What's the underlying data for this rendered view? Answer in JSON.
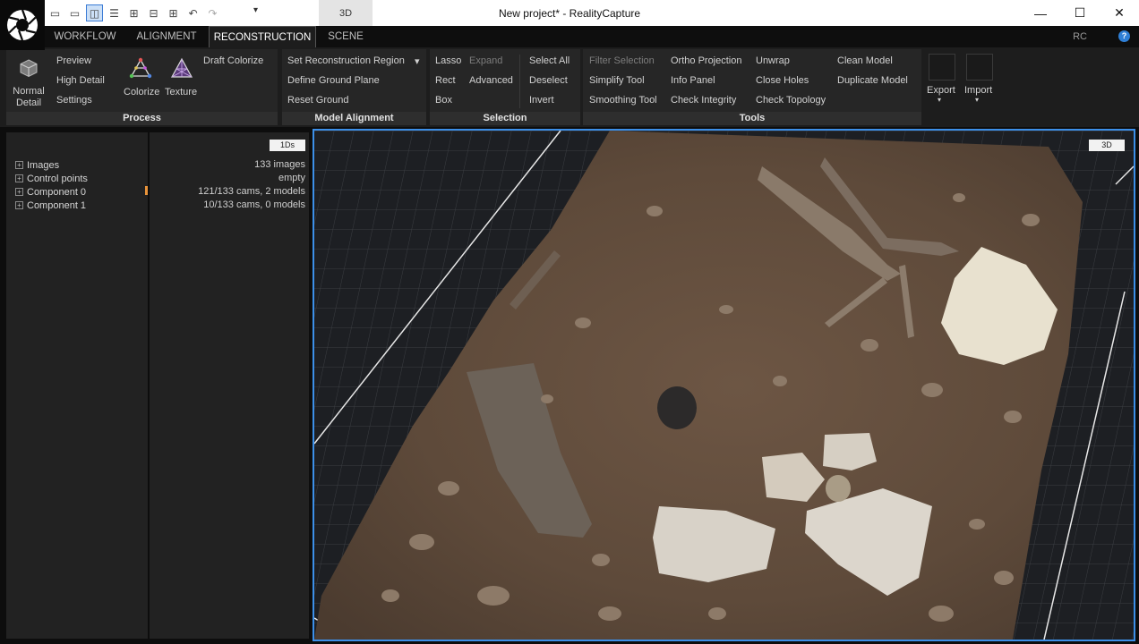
{
  "window": {
    "title": "New project* - RealityCapture",
    "context_tab": "3D",
    "minimize_symbol": "—",
    "maximize_symbol": "☐",
    "close_symbol": "✕"
  },
  "quick_access": {
    "dropdown_symbol": "▾",
    "icons": [
      "layout-1-icon",
      "layout-2-icon",
      "layout-3-icon",
      "layout-4-icon",
      "layout-5-icon",
      "layout-6-icon",
      "layout-7-icon",
      "undo-icon",
      "redo-icon"
    ]
  },
  "tabs": [
    "WORKFLOW",
    "ALIGNMENT",
    "RECONSTRUCTION",
    "SCENE"
  ],
  "active_tab": "RECONSTRUCTION",
  "rc_label": "RC",
  "help_symbol": "?",
  "ribbon": {
    "process": {
      "label": "Process",
      "normal_detail": [
        "Normal",
        "Detail"
      ],
      "preview": "Preview",
      "high_detail": "High Detail",
      "settings": "Settings",
      "colorize": "Colorize",
      "texture": "Texture",
      "draft_colorize": "Draft Colorize"
    },
    "model_alignment": {
      "label": "Model Alignment",
      "set_region": "Set Reconstruction Region",
      "define_ground": "Define Ground Plane",
      "reset_ground": "Reset Ground"
    },
    "selection": {
      "label": "Selection",
      "lasso": "Lasso",
      "expand": "Expand",
      "rect": "Rect",
      "advanced": "Advanced",
      "box": "Box",
      "select_all": "Select All",
      "deselect": "Deselect",
      "invert": "Invert"
    },
    "tools": {
      "label": "Tools",
      "filter_selection": "Filter Selection",
      "simplify": "Simplify Tool",
      "smoothing": "Smoothing Tool",
      "ortho": "Ortho Projection",
      "info_panel": "Info Panel",
      "check_integrity": "Check Integrity",
      "unwrap": "Unwrap",
      "close_holes": "Close Holes",
      "check_topology": "Check Topology",
      "clean_model": "Clean Model",
      "duplicate_model": "Duplicate Model"
    },
    "export_label": "Export",
    "import_label": "Import"
  },
  "panel_1ds": "1Ds",
  "tree": [
    {
      "label": "Images",
      "info": "133 images"
    },
    {
      "label": "Control points",
      "info": "empty"
    },
    {
      "label": "Component 0",
      "info": "121/133 cams, 2 models"
    },
    {
      "label": "Component 1",
      "info": "10/133 cams, 0 models"
    }
  ],
  "viewport_badge": "3D",
  "colors": {
    "accent": "#3c8fe8",
    "marker": "#e8933a",
    "ground": "#5e4a3a"
  }
}
